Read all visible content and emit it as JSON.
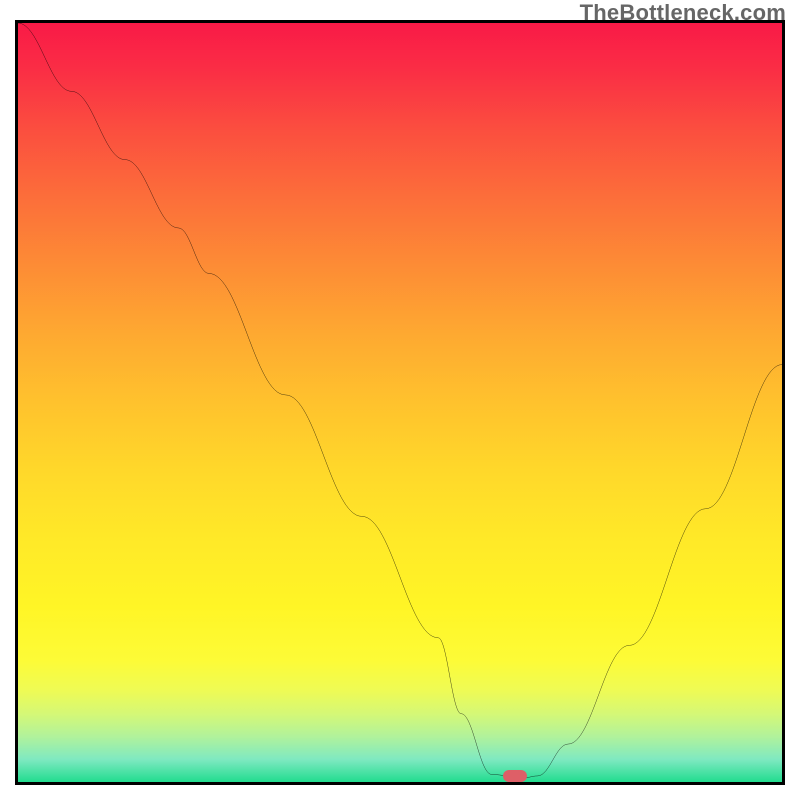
{
  "attribution": "TheBottleneck.com",
  "marker": {
    "x_pct": 65,
    "y_pct": 99.2
  },
  "chart_data": {
    "type": "line",
    "title": "",
    "xlabel": "",
    "ylabel": "",
    "xlim": [
      0,
      100
    ],
    "ylim": [
      0,
      100
    ],
    "series": [
      {
        "name": "curve",
        "x": [
          0,
          7,
          14,
          21,
          25,
          35,
          45,
          55,
          58,
          62,
          66,
          68,
          72,
          80,
          90,
          100
        ],
        "y": [
          100,
          91,
          82,
          73,
          67,
          51,
          35,
          19,
          9,
          1,
          0.5,
          0.8,
          5,
          18,
          36,
          55
        ]
      }
    ],
    "annotations": [
      {
        "type": "marker",
        "x": 65,
        "y": 0.8,
        "color": "#de5f67"
      }
    ],
    "gradient_stops": [
      {
        "pct": 0,
        "color": "#f91a47"
      },
      {
        "pct": 50,
        "color": "#ffc22d"
      },
      {
        "pct": 85,
        "color": "#fdfb37"
      },
      {
        "pct": 100,
        "color": "#22dc8f"
      }
    ]
  }
}
